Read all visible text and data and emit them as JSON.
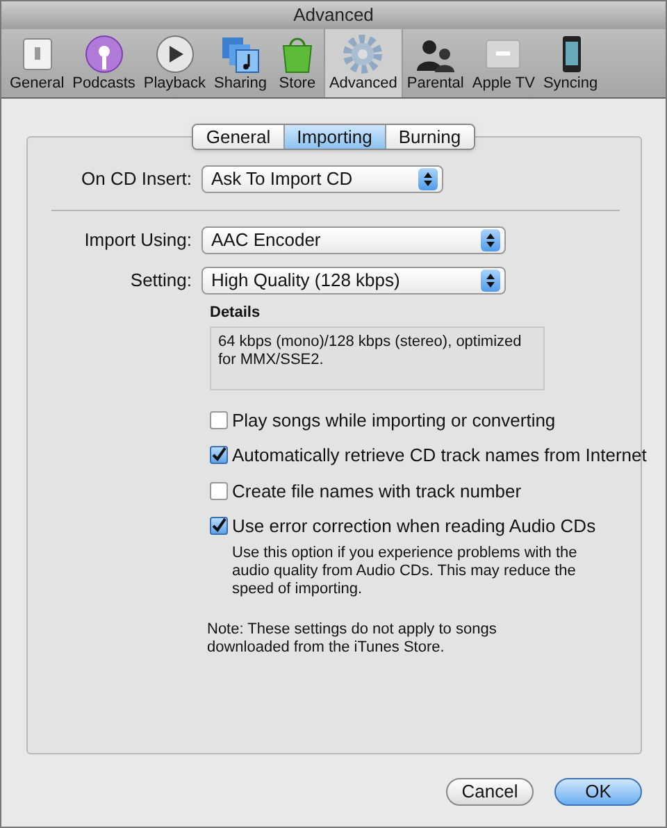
{
  "window": {
    "title": "Advanced"
  },
  "toolbar": [
    {
      "label": "General",
      "kind": "general",
      "selected": false
    },
    {
      "label": "Podcasts",
      "kind": "podcasts",
      "selected": false
    },
    {
      "label": "Playback",
      "kind": "playback",
      "selected": false
    },
    {
      "label": "Sharing",
      "kind": "sharing",
      "selected": false
    },
    {
      "label": "Store",
      "kind": "store",
      "selected": false
    },
    {
      "label": "Advanced",
      "kind": "advanced",
      "selected": true
    },
    {
      "label": "Parental",
      "kind": "parental",
      "selected": false
    },
    {
      "label": "Apple TV",
      "kind": "appletv",
      "selected": false
    },
    {
      "label": "Syncing",
      "kind": "syncing",
      "selected": false
    }
  ],
  "tabs": [
    {
      "label": "General",
      "selected": false
    },
    {
      "label": "Importing",
      "selected": true
    },
    {
      "label": "Burning",
      "selected": false
    }
  ],
  "on_cd_insert": {
    "label": "On CD Insert:",
    "value": "Ask To Import CD"
  },
  "import_using": {
    "label": "Import Using:",
    "value": "AAC Encoder"
  },
  "setting": {
    "label": "Setting:",
    "value": "High Quality (128 kbps)"
  },
  "details": {
    "label": "Details",
    "text": "64 kbps (mono)/128 kbps (stereo), optimized for MMX/SSE2."
  },
  "options": [
    {
      "label": "Play songs while importing or converting",
      "checked": false
    },
    {
      "label": "Automatically retrieve CD track names from Internet",
      "checked": true
    },
    {
      "label": "Create file names with track number",
      "checked": false
    },
    {
      "label": "Use error correction when reading Audio CDs",
      "checked": true,
      "description": "Use this option if you experience problems with the audio quality from Audio CDs. This may reduce the speed of importing."
    }
  ],
  "note": "Note: These settings do not apply to songs downloaded from the iTunes Store.",
  "buttons": [
    {
      "label": "Cancel",
      "default": false
    },
    {
      "label": "OK",
      "default": true
    }
  ]
}
